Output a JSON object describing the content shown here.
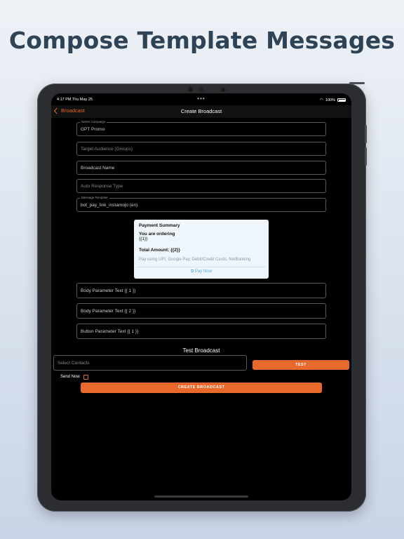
{
  "headline": "Compose Template Messages",
  "status_bar": {
    "time": "4:17 PM  Thu May 25",
    "dots": "•••",
    "battery": "100%"
  },
  "nav": {
    "back_label": "Broadcast",
    "title": "Create Broadcast"
  },
  "form": {
    "campaign": {
      "legend": "Select Campaign",
      "value": "GPT Promo"
    },
    "target_audience_placeholder": "Target Audience (Groups)",
    "broadcast_name_placeholder": "Broadcast Name",
    "auto_response_placeholder": "Auto Response Type",
    "message_template": {
      "legend": "Message Template",
      "value": "bot_pay_link_instamojo (en)"
    },
    "body_param_1": "Body Parameter Text {{ 1 }}",
    "body_param_2": "Body Parameter Text {{ 2 }}",
    "button_param_1": "Button Parameter Text {{ 1 }}"
  },
  "preview": {
    "title": "Payment Summary",
    "ordering": "You are ordering",
    "var1": "{{1}}",
    "total": "Total Amount: {{2}}",
    "methods": "Pay using UPI, Google Pay, Debit/Credit Cards, NetBanking",
    "pay_button": "Pay Now"
  },
  "test": {
    "title": "Test Broadcast",
    "contacts_placeholder": "Select Contacts",
    "test_button": "TEST"
  },
  "send_now_label": "Send Now",
  "send_now_checked": false,
  "create_button": "CREATE BROADCAST",
  "colors": {
    "accent": "#e8692b",
    "headline": "#2e4456",
    "screen_bg": "#000000",
    "card_bg": "#eef6fb"
  }
}
